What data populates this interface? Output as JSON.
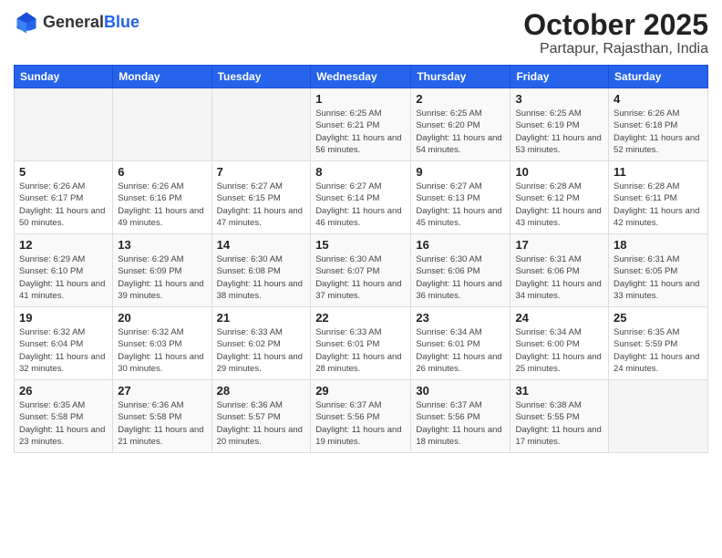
{
  "logo": {
    "general": "General",
    "blue": "Blue"
  },
  "header": {
    "month": "October 2025",
    "location": "Partapur, Rajasthan, India"
  },
  "weekdays": [
    "Sunday",
    "Monday",
    "Tuesday",
    "Wednesday",
    "Thursday",
    "Friday",
    "Saturday"
  ],
  "weeks": [
    [
      {
        "day": "",
        "info": ""
      },
      {
        "day": "",
        "info": ""
      },
      {
        "day": "",
        "info": ""
      },
      {
        "day": "1",
        "info": "Sunrise: 6:25 AM\nSunset: 6:21 PM\nDaylight: 11 hours\nand 56 minutes."
      },
      {
        "day": "2",
        "info": "Sunrise: 6:25 AM\nSunset: 6:20 PM\nDaylight: 11 hours\nand 54 minutes."
      },
      {
        "day": "3",
        "info": "Sunrise: 6:25 AM\nSunset: 6:19 PM\nDaylight: 11 hours\nand 53 minutes."
      },
      {
        "day": "4",
        "info": "Sunrise: 6:26 AM\nSunset: 6:18 PM\nDaylight: 11 hours\nand 52 minutes."
      }
    ],
    [
      {
        "day": "5",
        "info": "Sunrise: 6:26 AM\nSunset: 6:17 PM\nDaylight: 11 hours\nand 50 minutes."
      },
      {
        "day": "6",
        "info": "Sunrise: 6:26 AM\nSunset: 6:16 PM\nDaylight: 11 hours\nand 49 minutes."
      },
      {
        "day": "7",
        "info": "Sunrise: 6:27 AM\nSunset: 6:15 PM\nDaylight: 11 hours\nand 47 minutes."
      },
      {
        "day": "8",
        "info": "Sunrise: 6:27 AM\nSunset: 6:14 PM\nDaylight: 11 hours\nand 46 minutes."
      },
      {
        "day": "9",
        "info": "Sunrise: 6:27 AM\nSunset: 6:13 PM\nDaylight: 11 hours\nand 45 minutes."
      },
      {
        "day": "10",
        "info": "Sunrise: 6:28 AM\nSunset: 6:12 PM\nDaylight: 11 hours\nand 43 minutes."
      },
      {
        "day": "11",
        "info": "Sunrise: 6:28 AM\nSunset: 6:11 PM\nDaylight: 11 hours\nand 42 minutes."
      }
    ],
    [
      {
        "day": "12",
        "info": "Sunrise: 6:29 AM\nSunset: 6:10 PM\nDaylight: 11 hours\nand 41 minutes."
      },
      {
        "day": "13",
        "info": "Sunrise: 6:29 AM\nSunset: 6:09 PM\nDaylight: 11 hours\nand 39 minutes."
      },
      {
        "day": "14",
        "info": "Sunrise: 6:30 AM\nSunset: 6:08 PM\nDaylight: 11 hours\nand 38 minutes."
      },
      {
        "day": "15",
        "info": "Sunrise: 6:30 AM\nSunset: 6:07 PM\nDaylight: 11 hours\nand 37 minutes."
      },
      {
        "day": "16",
        "info": "Sunrise: 6:30 AM\nSunset: 6:06 PM\nDaylight: 11 hours\nand 36 minutes."
      },
      {
        "day": "17",
        "info": "Sunrise: 6:31 AM\nSunset: 6:06 PM\nDaylight: 11 hours\nand 34 minutes."
      },
      {
        "day": "18",
        "info": "Sunrise: 6:31 AM\nSunset: 6:05 PM\nDaylight: 11 hours\nand 33 minutes."
      }
    ],
    [
      {
        "day": "19",
        "info": "Sunrise: 6:32 AM\nSunset: 6:04 PM\nDaylight: 11 hours\nand 32 minutes."
      },
      {
        "day": "20",
        "info": "Sunrise: 6:32 AM\nSunset: 6:03 PM\nDaylight: 11 hours\nand 30 minutes."
      },
      {
        "day": "21",
        "info": "Sunrise: 6:33 AM\nSunset: 6:02 PM\nDaylight: 11 hours\nand 29 minutes."
      },
      {
        "day": "22",
        "info": "Sunrise: 6:33 AM\nSunset: 6:01 PM\nDaylight: 11 hours\nand 28 minutes."
      },
      {
        "day": "23",
        "info": "Sunrise: 6:34 AM\nSunset: 6:01 PM\nDaylight: 11 hours\nand 26 minutes."
      },
      {
        "day": "24",
        "info": "Sunrise: 6:34 AM\nSunset: 6:00 PM\nDaylight: 11 hours\nand 25 minutes."
      },
      {
        "day": "25",
        "info": "Sunrise: 6:35 AM\nSunset: 5:59 PM\nDaylight: 11 hours\nand 24 minutes."
      }
    ],
    [
      {
        "day": "26",
        "info": "Sunrise: 6:35 AM\nSunset: 5:58 PM\nDaylight: 11 hours\nand 23 minutes."
      },
      {
        "day": "27",
        "info": "Sunrise: 6:36 AM\nSunset: 5:58 PM\nDaylight: 11 hours\nand 21 minutes."
      },
      {
        "day": "28",
        "info": "Sunrise: 6:36 AM\nSunset: 5:57 PM\nDaylight: 11 hours\nand 20 minutes."
      },
      {
        "day": "29",
        "info": "Sunrise: 6:37 AM\nSunset: 5:56 PM\nDaylight: 11 hours\nand 19 minutes."
      },
      {
        "day": "30",
        "info": "Sunrise: 6:37 AM\nSunset: 5:56 PM\nDaylight: 11 hours\nand 18 minutes."
      },
      {
        "day": "31",
        "info": "Sunrise: 6:38 AM\nSunset: 5:55 PM\nDaylight: 11 hours\nand 17 minutes."
      },
      {
        "day": "",
        "info": ""
      }
    ]
  ]
}
